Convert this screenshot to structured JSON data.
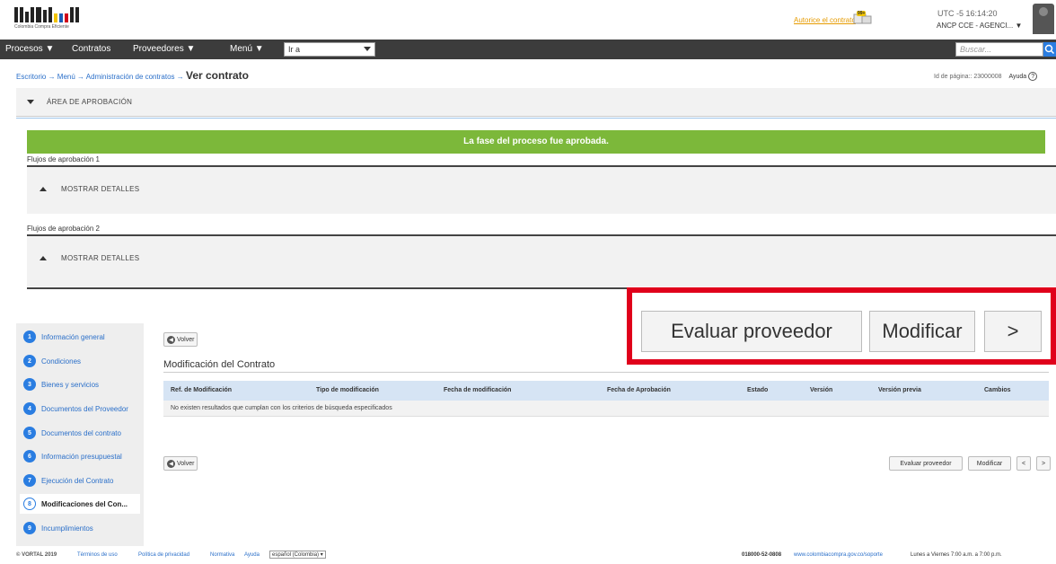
{
  "header": {
    "logo_text": "Colombia Compra Eficiente",
    "link": "Autorice el contrato",
    "message_count": "99+",
    "utc": "UTC -5 16:14:20",
    "account": "ANCP CCE - AGENCI..."
  },
  "nav": {
    "items": [
      "Procesos",
      "Contratos",
      "Proveedores",
      "Menú"
    ],
    "goto_value": "Ir a",
    "search_placeholder": "Buscar..."
  },
  "breadcrumb": {
    "path": "Escritorio → Menú → Administración de contratos →",
    "current": "Ver contrato",
    "page_id": "Id de página:: 23000008",
    "help": "Ayuda"
  },
  "approval": {
    "section_title": "ÁREA DE APROBACIÓN",
    "banner": "La fase del proceso fue aprobada.",
    "flows": [
      {
        "label": "Flujos de aprobación 1",
        "toggle": "MOSTRAR DETALLES"
      },
      {
        "label": "Flujos de aprobación 2",
        "toggle": "MOSTRAR DETALLES"
      }
    ]
  },
  "highlight": {
    "buttons": [
      "Evaluar proveedor",
      "Modificar",
      ">"
    ]
  },
  "sidenav": {
    "steps": [
      {
        "num": "1",
        "label": "Información general"
      },
      {
        "num": "2",
        "label": "Condiciones"
      },
      {
        "num": "3",
        "label": "Bienes y servicios"
      },
      {
        "num": "4",
        "label": "Documentos del Proveedor"
      },
      {
        "num": "5",
        "label": "Documentos del contrato"
      },
      {
        "num": "6",
        "label": "Información presupuestal"
      },
      {
        "num": "7",
        "label": "Ejecución del Contrato"
      },
      {
        "num": "8",
        "label": "Modificaciones del Con..."
      },
      {
        "num": "9",
        "label": "Incumplimientos"
      }
    ],
    "active_index": 7
  },
  "main": {
    "back_label": "Volver",
    "title": "Modificación del Contrato",
    "columns": [
      "Ref. de Modificación",
      "Tipo de modificación",
      "Fecha de modificación",
      "Fecha de Aprobación",
      "Estado",
      "Versión",
      "Versión previa",
      "Cambios"
    ],
    "empty_message": "No existen resultados que cumplan con los criterios de búsqueda especificados",
    "bottom_buttons": [
      "Evaluar proveedor",
      "Modificar",
      "<",
      ">"
    ]
  },
  "footer": {
    "copyright": "© VORTAL 2019",
    "links": [
      "Términos de uso",
      "Política de privacidad",
      "Normativa",
      "Ayuda"
    ],
    "language": "español (Colombia)",
    "phone": "018000-52-0808",
    "site": "www.colombiacompra.gov.co/soporte",
    "hours": "Lunes a Viernes 7:00 a.m. a 7:00 p.m."
  },
  "colors": {
    "accent": "#2a7de1",
    "success": "#7cb83a",
    "highlight_border": "#e0001b",
    "nav_bg": "#3c3c3c"
  }
}
